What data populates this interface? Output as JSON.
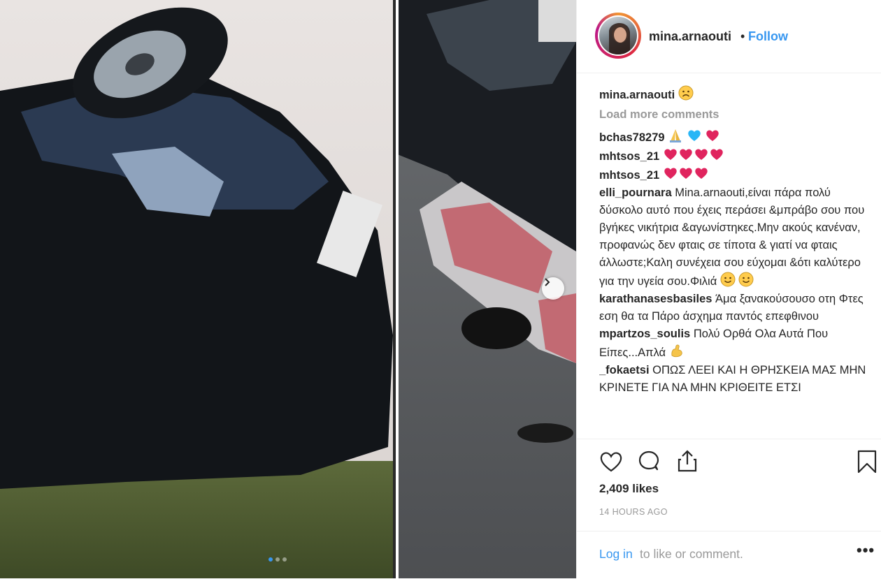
{
  "header": {
    "username": "mina.arnaouti",
    "separator": "•",
    "follow_label": "Follow"
  },
  "caption": {
    "username": "mina.arnaouti",
    "emoji": "☹"
  },
  "load_more": "Load more comments",
  "comments": [
    {
      "username": "bchas78279",
      "emojis": [
        "folded-hands",
        "blue-heart",
        "red-heart"
      ]
    },
    {
      "username": "mhtsos_21",
      "emojis": [
        "red-heart",
        "red-heart",
        "red-heart",
        "red-heart"
      ]
    },
    {
      "username": "mhtsos_21",
      "emojis": [
        "red-heart",
        "red-heart",
        "red-heart"
      ]
    },
    {
      "username": "elli_pournara",
      "text": "Mina.arnaouti,είναι πάρα πολύ δύσκολο αυτό που έχεις περάσει &μπράβο σου που βγήκες νικήτρια &αγωνίστηκες.Μην ακούς κανέναν, προφανώς δεν φταις σε τίποτα & γιατί να φταις άλλωστε;Καλη συνέχεια σου εύχομαι &ότι καλύτερο για την υγεία σου.Φιλιά"
    },
    {
      "username": "karathanasesbasiles",
      "text": "Άμα ξανακούσουσο οτη Φτες εση θα τα Πάρο άσχημα παντός επεφθινου"
    },
    {
      "username": "mpartzos_soulis",
      "text": "Πολύ Ορθά Ολα Αυτά Που Είπες...Απλά"
    },
    {
      "username": "_fokaetsi",
      "text": "ΟΠΩΣ ΛΕΕΙ ΚΑΙ Η ΘΡΗΣΚΕΙΑ ΜΑΣ ΜΗΝ ΚΡΙΝΕΤΕ ΓΙΑ ΝΑ ΜΗΝ ΚΡΙΘΕΙΤΕ ΕΤΣΙ"
    }
  ],
  "likes": "2,409 likes",
  "timestamp": "14 HOURS AGO",
  "footer": {
    "login_label": "Log in",
    "login_rest": "to like or comment.",
    "more_label": "•••"
  },
  "colors": {
    "link_blue": "#3897f0",
    "text": "#262626",
    "muted": "#999999",
    "heart_red": "#e0245e",
    "heart_blue": "#29b6f6"
  }
}
